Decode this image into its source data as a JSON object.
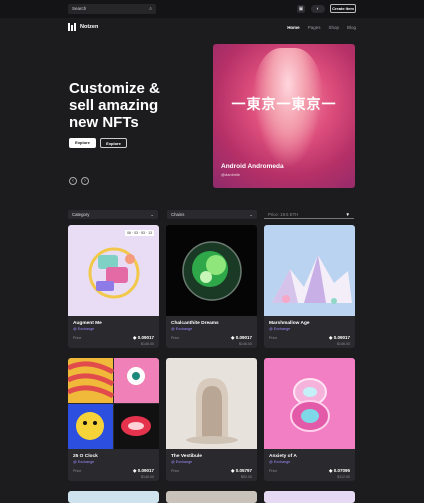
{
  "topbar": {
    "search_placeholder": "Search",
    "search_icon": "search-icon",
    "wallet_icon": "wallet-icon",
    "theme_icon": "theme-toggle-icon",
    "create_label": "Create Item"
  },
  "brand": {
    "name": "Notzen"
  },
  "nav": {
    "items": [
      "Home",
      "Pages",
      "Shop",
      "Blog"
    ],
    "active": "Home"
  },
  "hero": {
    "title": "Customize & sell amazing new NFTs",
    "primary_button": "Explore",
    "secondary_button": "Explore",
    "prev_icon": "chevron-left-icon",
    "next_icon": "chevron-right-icon",
    "featured": {
      "kanji": "一東京一東京一",
      "title": "Android Andromeda",
      "user": "@danimile"
    }
  },
  "filters": {
    "category": "Category",
    "chains": "Chains",
    "price": "Price: 19.5 ETH"
  },
  "nfts": [
    {
      "name": "Augment Me",
      "exchange": "@ Exchange",
      "price_label": "Price",
      "price": "◆ 0.09017",
      "usd": "$146.00",
      "stamp": "06 · 03 · 53 · 13"
    },
    {
      "name": "Chalcanthite Dreams",
      "exchange": "@ Exchange",
      "price_label": "Price",
      "price": "◆ 0.09017",
      "usd": "$146.00"
    },
    {
      "name": "Marshmallow Age",
      "exchange": "@ Exchange",
      "price_label": "Price",
      "price": "◆ 0.09017",
      "usd": "$146.00"
    },
    {
      "name": "25 O Clock",
      "exchange": "@ Exchange",
      "price_label": "Price",
      "price": "◆ 0.09017",
      "usd": "$146.00"
    },
    {
      "name": "The Vestibule",
      "exchange": "@ Exchange",
      "price_label": "Price",
      "price": "◆ 0.05797",
      "usd": "$92.00"
    },
    {
      "name": "Anxiety of A",
      "exchange": "@ Exchange",
      "price_label": "Price",
      "price": "◆ 0.07095",
      "usd": "$112.00"
    }
  ]
}
